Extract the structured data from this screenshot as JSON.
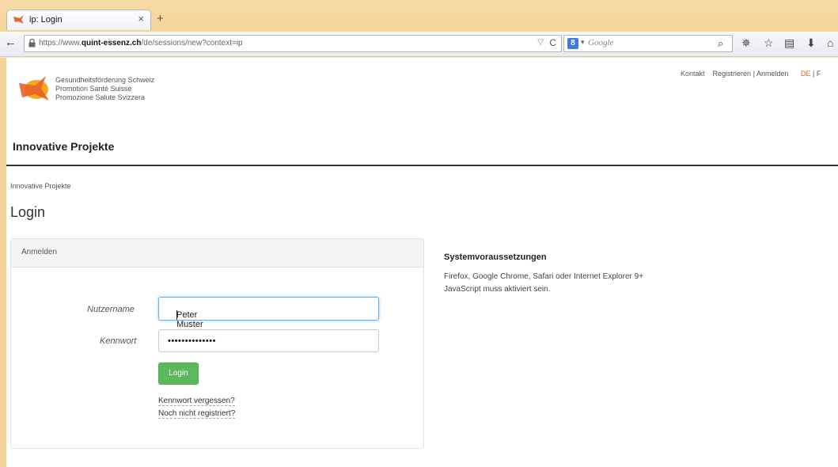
{
  "browser": {
    "tab_title": "ip: Login",
    "tab_close": "×",
    "new_tab": "+",
    "url_prefix": "https://www.",
    "url_domain": "quint-essenz.ch",
    "url_path": "/de/sessions/new?context=ip",
    "url_dropdown": "▽",
    "reload": "C",
    "search_engine_dropdown": "▾",
    "search_placeholder": "Google",
    "icons": [
      "search-icon",
      "settings-icon",
      "bookmark-star-icon",
      "reading-list-icon",
      "download-icon",
      "home-icon"
    ]
  },
  "header": {
    "logo_lines": [
      "Gesundheitsförderung Schweiz",
      "Promotion Santé Suisse",
      "Promozione Salute Svizzera"
    ],
    "nav_kontakt": "Kontakt",
    "nav_register": "Registrieren",
    "nav_sep": "|",
    "nav_login": "Anmelden",
    "nav_lang": "DE",
    "nav_lang_sep": "| F",
    "site_title": "Innovative Projekte"
  },
  "breadcrumb": "Innovative Projekte",
  "page_title": "Login",
  "login_panel": {
    "heading": "Anmelden",
    "username_label": "Nutzername",
    "username_value": "Peter Muster",
    "password_label": "Kennwort",
    "password_value": "••••••••••••••",
    "submit_label": "Login",
    "forgot_link": "Kennwort vergessen?",
    "register_link": "Noch nicht registriert?"
  },
  "requirements": {
    "title": "Systemvoraussetzungen",
    "line1": "Firefox, Google Chrome, Safari oder Internet Explorer 9+",
    "line2": "JavaScript muss aktiviert sein."
  },
  "colors": {
    "accent_orange": "#e8622a",
    "button_green": "#5cb85c",
    "input_focus": "#66afe9"
  }
}
